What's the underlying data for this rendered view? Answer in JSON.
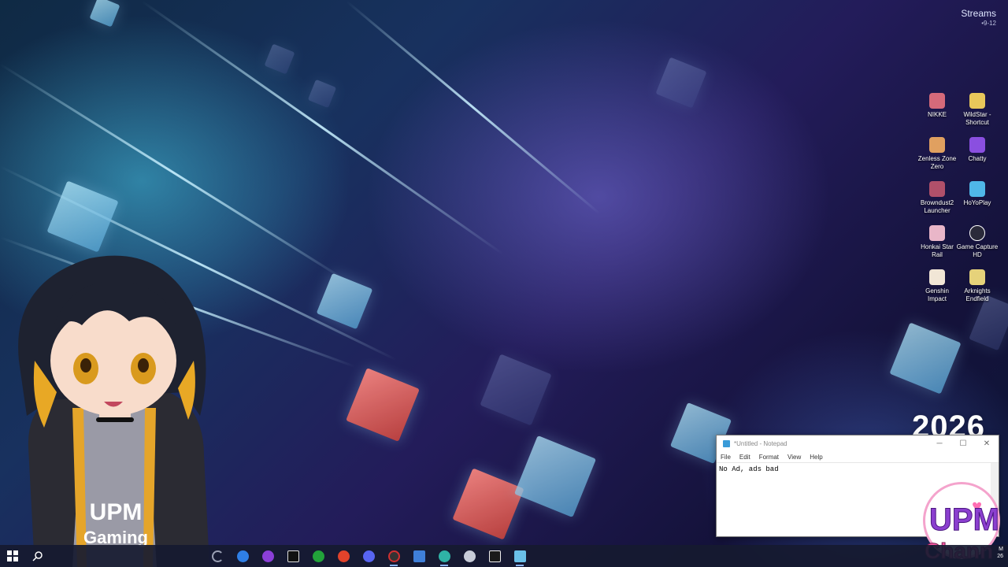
{
  "widget": {
    "title": "Streams",
    "subtitle": "•9-12"
  },
  "desktop_icons": [
    {
      "label": "NIKKE",
      "color": "#d56a7a"
    },
    {
      "label": "WildStar - Shortcut",
      "color": "#e8c75a"
    },
    {
      "label": "Zenless Zone Zero",
      "color": "#e0a060"
    },
    {
      "label": "Chatty",
      "color": "#8a4fe0"
    },
    {
      "label": "Browndust2 Launcher",
      "color": "#b0506a"
    },
    {
      "label": "HoYoPlay",
      "color": "#4fb7e8"
    },
    {
      "label": "Honkai Star Rail",
      "color": "#e9b6c8"
    },
    {
      "label": "Game Capture HD",
      "color": "#2a2a3a"
    },
    {
      "label": "Genshin Impact",
      "color": "#f1e6d6"
    },
    {
      "label": "Arknights Endfield",
      "color": "#e6d27a"
    }
  ],
  "year_text": "2026",
  "notepad": {
    "title": "*Untitled - Notepad",
    "menu": [
      "File",
      "Edit",
      "Format",
      "View",
      "Help"
    ],
    "content": "No Ad, ads bad",
    "controls": {
      "minimize": "─",
      "maximize": "☐",
      "close": "✕"
    }
  },
  "logo": {
    "line1": "UPM",
    "line2": "Chann",
    "heart": "♥"
  },
  "avatar": {
    "shirt_line1": "UPM",
    "shirt_line2": "Gaming"
  },
  "taskbar": {
    "items": [
      {
        "name": "start",
        "color": "#ffffff"
      },
      {
        "name": "search",
        "color": "#ffffff"
      },
      {
        "name": "loading",
        "color": "#9aa0b4"
      },
      {
        "name": "app-blue",
        "color": "#2f7fe6"
      },
      {
        "name": "app-purple",
        "color": "#8b3fd8"
      },
      {
        "name": "epic",
        "color": "#111111"
      },
      {
        "name": "xbox",
        "color": "#22a33a"
      },
      {
        "name": "app-red",
        "color": "#e2432b"
      },
      {
        "name": "discord",
        "color": "#5865f2"
      },
      {
        "name": "app-gauge",
        "color": "#d03030"
      },
      {
        "name": "app-square",
        "color": "#3f7fd8"
      },
      {
        "name": "edge",
        "color": "#2fb3a6"
      },
      {
        "name": "app-gear",
        "color": "#c8ccd8"
      },
      {
        "name": "app-capcut",
        "color": "#1a1a1a"
      },
      {
        "name": "notepad",
        "color": "#6ac0e8"
      }
    ]
  },
  "clock_fragments": {
    "top": "M",
    "bottom": "26"
  }
}
